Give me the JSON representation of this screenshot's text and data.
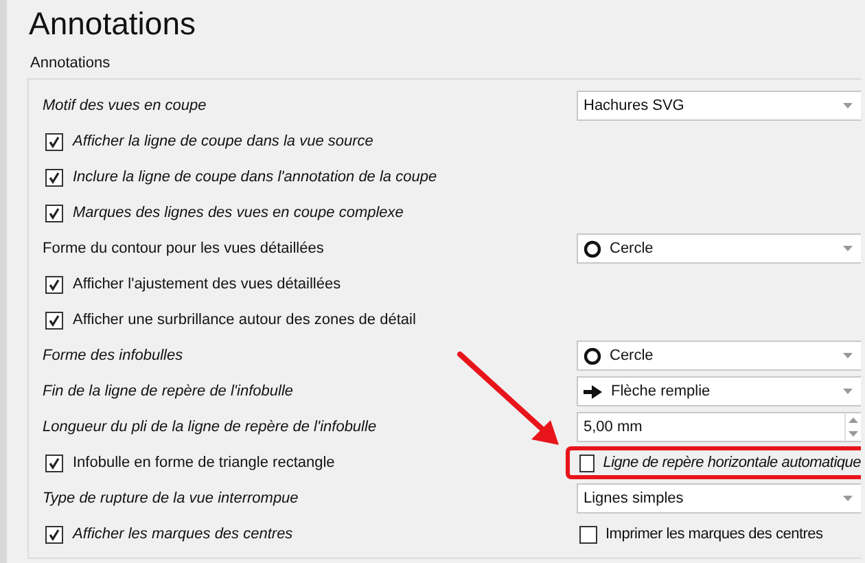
{
  "title": "Annotations",
  "group": {
    "label": "Annotations",
    "rows": [
      {
        "left": {
          "kind": "label",
          "text": "Motif des vues en coupe",
          "italic": true
        },
        "right": {
          "kind": "dropdown",
          "value": "Hachures SVG"
        }
      },
      {
        "left": {
          "kind": "check",
          "text": "Afficher la ligne de coupe dans la vue source",
          "italic": true,
          "checked": true
        }
      },
      {
        "left": {
          "kind": "check",
          "text": "Inclure la ligne de coupe dans l'annotation de la coupe",
          "italic": true,
          "checked": true
        }
      },
      {
        "left": {
          "kind": "check",
          "text": "Marques des lignes des vues en coupe complexe",
          "italic": true,
          "checked": true
        }
      },
      {
        "left": {
          "kind": "label",
          "text": "Forme du contour pour les vues détaillées",
          "italic": false
        },
        "right": {
          "kind": "circle-dropdown",
          "value": "Cercle"
        }
      },
      {
        "left": {
          "kind": "check",
          "text": "Afficher l'ajustement des vues détaillées",
          "italic": false,
          "checked": true
        }
      },
      {
        "left": {
          "kind": "check",
          "text": "Afficher une surbrillance autour des zones de détail",
          "italic": false,
          "checked": true
        }
      },
      {
        "left": {
          "kind": "label",
          "text": "Forme des infobulles",
          "italic": true
        },
        "right": {
          "kind": "circle-dropdown",
          "value": "Cercle"
        }
      },
      {
        "left": {
          "kind": "label",
          "text": "Fin de la ligne de repère de l'infobulle",
          "italic": true
        },
        "right": {
          "kind": "arrow-dropdown",
          "value": "Flèche remplie"
        }
      },
      {
        "left": {
          "kind": "label",
          "text": "Longueur du pli de la ligne de repère de l'infobulle",
          "italic": true
        },
        "right": {
          "kind": "spinbox",
          "value": "5,00 mm"
        }
      },
      {
        "left": {
          "kind": "check",
          "text": "Infobulle en forme de triangle rectangle",
          "italic": false,
          "checked": true
        },
        "right": {
          "kind": "check",
          "text": "Ligne de repère horizontale automatique",
          "italic": true,
          "checked": false,
          "highlighted": true
        }
      },
      {
        "left": {
          "kind": "label",
          "text": "Type de rupture de la vue interrompue",
          "italic": true
        },
        "right": {
          "kind": "dropdown",
          "value": "Lignes simples"
        }
      },
      {
        "left": {
          "kind": "check",
          "text": "Afficher les marques des centres",
          "italic": true,
          "checked": true
        },
        "right": {
          "kind": "check",
          "text": "Imprimer les marques des centres",
          "italic": false,
          "checked": false
        }
      }
    ]
  }
}
